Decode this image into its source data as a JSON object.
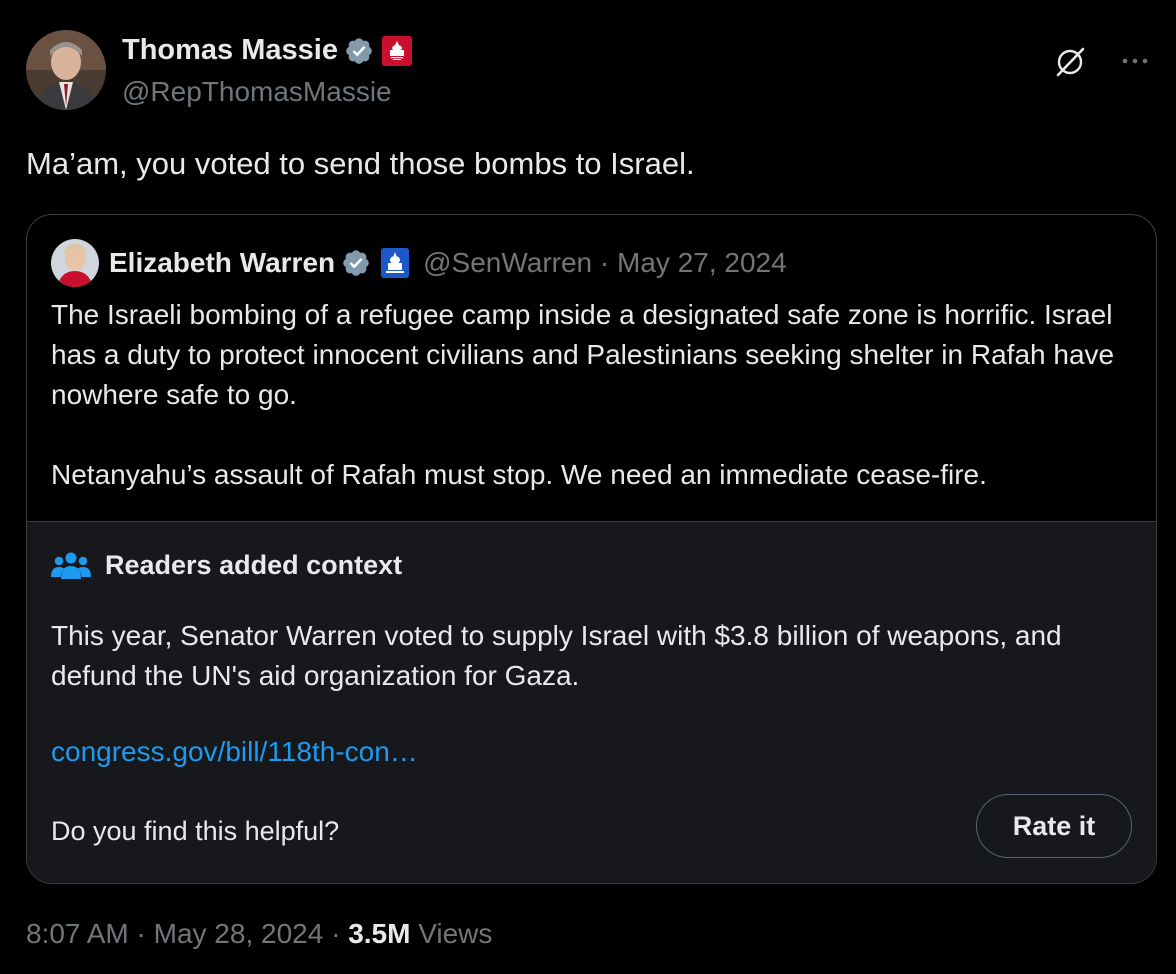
{
  "author": {
    "name": "Thomas Massie",
    "handle": "@RepThomasMassie"
  },
  "tweet": {
    "text": "Ma’am, you voted to send those bombs to Israel."
  },
  "quoted": {
    "name": "Elizabeth Warren",
    "handle": "@SenWarren",
    "separator": " · ",
    "date": "May 27, 2024",
    "paragraphs": [
      "The Israeli bombing of a refugee camp inside a designated safe zone is horrific. Israel has a duty to protect innocent civilians and Palestinians seeking shelter in Rafah have nowhere safe to go.",
      "Netanyahu’s assault of Rafah must stop. We need an immediate cease-fire."
    ]
  },
  "community_note": {
    "title": "Readers added context",
    "body": "This year, Senator Warren voted to supply Israel with $3.8 billion of weapons, and defund the UN's aid organization for Gaza.",
    "link": "congress.gov/bill/118th-con…",
    "question": "Do you find this helpful?",
    "rate_label": "Rate it"
  },
  "footer": {
    "time": "8:07 AM",
    "sep1": " · ",
    "date": "May 28, 2024",
    "sep2": " · ",
    "views_count": "3.5M",
    "views_label": " Views"
  },
  "icons": {
    "verified": "verified-badge-icon",
    "gov_badge": "congress-badge-icon",
    "grok": "grok-icon",
    "more": "more-icon",
    "people": "people-icon"
  },
  "colors": {
    "background": "#000000",
    "text": "#e7e9ea",
    "muted": "#71767b",
    "accent": "#1d9bf0",
    "verified_gray": "#829aab",
    "notes_bg": "#16181c"
  }
}
